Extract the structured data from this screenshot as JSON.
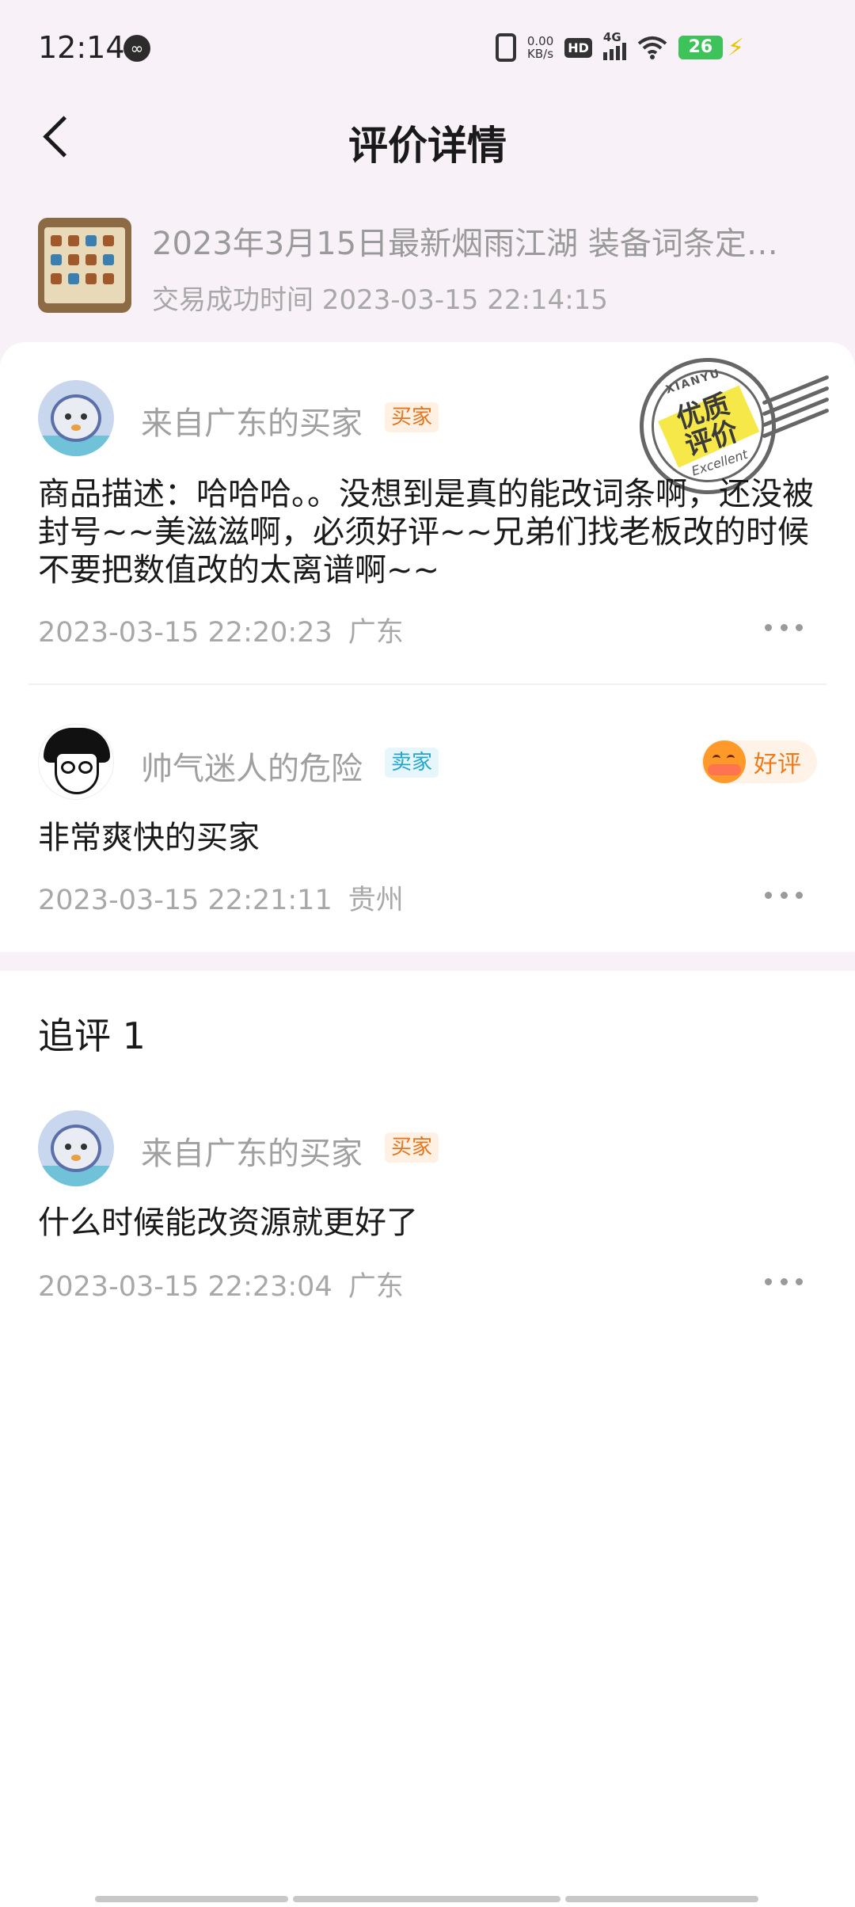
{
  "status_bar": {
    "time": "12:14",
    "speed_value": "0.00",
    "speed_unit": "KB/s",
    "hd": "HD",
    "network": "4G",
    "battery": "26"
  },
  "header": {
    "title": "评价详情"
  },
  "product": {
    "title": "2023年3月15日最新烟雨江湖 装备词条定…",
    "trade_time": "交易成功时间 2023-03-15 22:14:15"
  },
  "stamp": {
    "top": "XIANYU",
    "main": "优质\n评价",
    "bottom": "Excellent"
  },
  "reviews": [
    {
      "username": "来自广东的买家",
      "role": "买家",
      "text": "商品描述：哈哈哈。。没想到是真的能改词条啊，还没被封号~~美滋滋啊，必须好评~~兄弟们找老板改的时候不要把数值改的太离谱啊~~",
      "time": "2023-03-15 22:20:23",
      "location": "广东"
    },
    {
      "username": "帅气迷人的危险",
      "role": "卖家",
      "rating": "好评",
      "text": "非常爽快的买家",
      "time": "2023-03-15 22:21:11",
      "location": "贵州"
    }
  ],
  "followup": {
    "title": "追评 1",
    "username": "来自广东的买家",
    "role": "买家",
    "text": "什么时候能改资源就更好了",
    "time": "2023-03-15 22:23:04",
    "location": "广东"
  },
  "colors": {
    "page_tint": "#f8f2f8",
    "buyer_tag": "#e8741c",
    "seller_tag": "#22a6d0",
    "rating_orange": "#f07a1a"
  }
}
